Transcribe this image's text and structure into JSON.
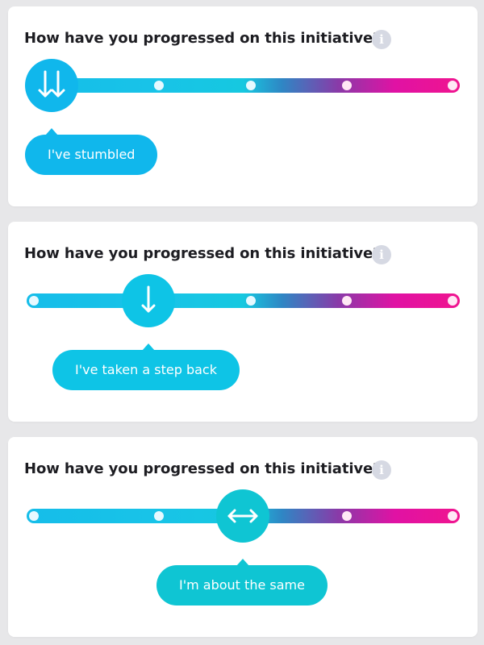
{
  "colors": {
    "page_background": "#e7e7e9",
    "card_background": "#ffffff",
    "question_text": "#1d1d22",
    "info_icon": "#d6d9e3",
    "track_start": "#15bde9",
    "track_end": "#f0148f",
    "knob_stumbled": "#10b7ec",
    "knob_step_back": "#0ec4e6",
    "knob_same": "#0fc5d3"
  },
  "scale": {
    "positions": 5,
    "stop_colors": [
      "cyan",
      "cyan",
      "cyan",
      "magenta",
      "magenta"
    ]
  },
  "cards": [
    {
      "question": "How have you progressed on this initiative?",
      "info_icon": "info-icon",
      "selected_index": 0,
      "knob_icon": "double-down-arrow-icon",
      "response_label": "I've stumbled"
    },
    {
      "question": "How have you progressed on this initiative?",
      "info_icon": "info-icon",
      "selected_index": 1,
      "knob_icon": "down-arrow-icon",
      "response_label": "I've taken a step back"
    },
    {
      "question": "How have you progressed on this initiative?",
      "info_icon": "info-icon",
      "selected_index": 2,
      "knob_icon": "left-right-arrow-icon",
      "response_label": "I'm about the same"
    }
  ]
}
